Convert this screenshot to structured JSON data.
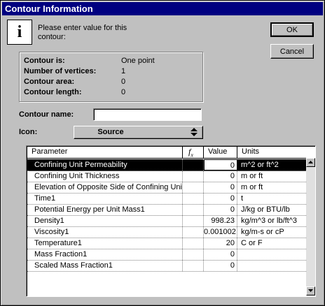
{
  "window": {
    "title": "Contour Information"
  },
  "message": "Please enter value for this contour:",
  "buttons": {
    "ok": "OK",
    "cancel": "Cancel"
  },
  "summary": [
    {
      "label": "Contour is:",
      "value": "One point"
    },
    {
      "label": "Number of vertices:",
      "value": "1"
    },
    {
      "label": "Contour area:",
      "value": "0"
    },
    {
      "label": "Contour length:",
      "value": "0"
    }
  ],
  "contour_name": {
    "label": "Contour name:",
    "value": ""
  },
  "icon_field": {
    "label": "Icon:",
    "selected": "Source"
  },
  "table": {
    "headers": {
      "parameter": "Parameter",
      "fx": "f",
      "value": "Value",
      "units": "Units"
    },
    "rows": [
      {
        "parameter": "Confining Unit Permeability",
        "value": "0",
        "units": "m^2 or ft^2"
      },
      {
        "parameter": "Confining Unit Thickness",
        "value": "0",
        "units": "m or ft"
      },
      {
        "parameter": "Elevation of Opposite Side of Confining Unit",
        "value": "0",
        "units": "m or ft"
      },
      {
        "parameter": "Time1",
        "value": "0",
        "units": "t"
      },
      {
        "parameter": "Potential Energy per Unit Mass1",
        "value": "0",
        "units": "J/kg or BTU/lb"
      },
      {
        "parameter": "Density1",
        "value": "998.23",
        "units": "kg/m^3 or lb/ft^3"
      },
      {
        "parameter": "Viscosity1",
        "value": "0.001002",
        "units": "kg/m-s or cP"
      },
      {
        "parameter": "Temperature1",
        "value": "20",
        "units": "C or F"
      },
      {
        "parameter": "Mass Fraction1",
        "value": "0",
        "units": ""
      },
      {
        "parameter": "Scaled Mass Fraction1",
        "value": "0",
        "units": ""
      }
    ]
  }
}
